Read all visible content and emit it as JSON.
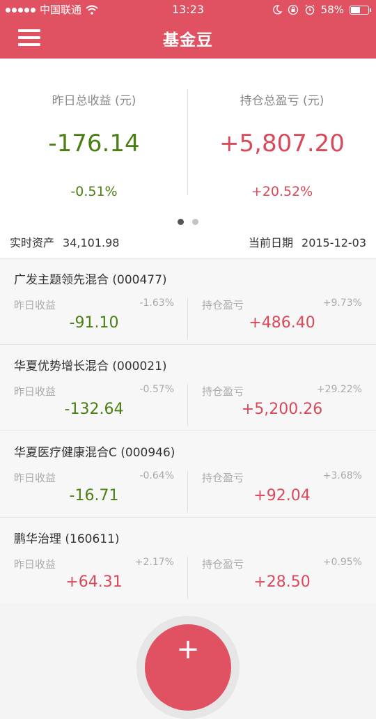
{
  "status_bar": {
    "carrier": "中国联通",
    "time": "13:23",
    "battery_text": "58%",
    "battery_level": 0.58,
    "icons": [
      "signal-dots-icon",
      "wifi-icon",
      "moon-icon",
      "rotation-lock-icon",
      "alarm-icon",
      "battery-icon"
    ]
  },
  "header": {
    "title": "基金豆",
    "menu_icon": "hamburger-menu-icon",
    "background": "#e05262"
  },
  "summary": {
    "yesterday": {
      "label": "昨日总收益 (元)",
      "value": "-176.14",
      "pct": "-0.51%"
    },
    "holding": {
      "label": "持仓总盈亏 (元)",
      "value": "+5,807.20",
      "pct": "+20.52%"
    },
    "pager": {
      "pages": 2,
      "active": 1
    }
  },
  "assets": {
    "realtime_label": "实时资产",
    "realtime_value": "34,101.98",
    "date_label": "当前日期",
    "date_value": "2015-12-03"
  },
  "funds": [
    {
      "name": "广发主题领先混合 (000477)",
      "yesterday_label": "昨日收益",
      "yesterday_pct": "-1.63%",
      "yesterday_value": "-91.10",
      "holding_label": "持仓盈亏",
      "holding_pct": "+9.73%",
      "holding_value": "+486.40"
    },
    {
      "name": "华夏优势增长混合 (000021)",
      "yesterday_label": "昨日收益",
      "yesterday_pct": "-0.57%",
      "yesterday_value": "-132.64",
      "holding_label": "持仓盈亏",
      "holding_pct": "+29.22%",
      "holding_value": "+5,200.26"
    },
    {
      "name": "华夏医疗健康混合C (000946)",
      "yesterday_label": "昨日收益",
      "yesterday_pct": "-0.64%",
      "yesterday_value": "-16.71",
      "holding_label": "持仓盈亏",
      "holding_pct": "+3.68%",
      "holding_value": "+92.04"
    },
    {
      "name": "鹏华治理 (160611)",
      "yesterday_label": "昨日收益",
      "yesterday_pct": "+2.17%",
      "yesterday_value": "+64.31",
      "holding_label": "持仓盈亏",
      "holding_pct": "+0.95%",
      "holding_value": "+28.50"
    }
  ],
  "fab": {
    "label": "+",
    "icon": "plus-icon"
  },
  "colors": {
    "accent": "#e05262",
    "gain": "#d9495a",
    "loss": "#4a7f13"
  }
}
